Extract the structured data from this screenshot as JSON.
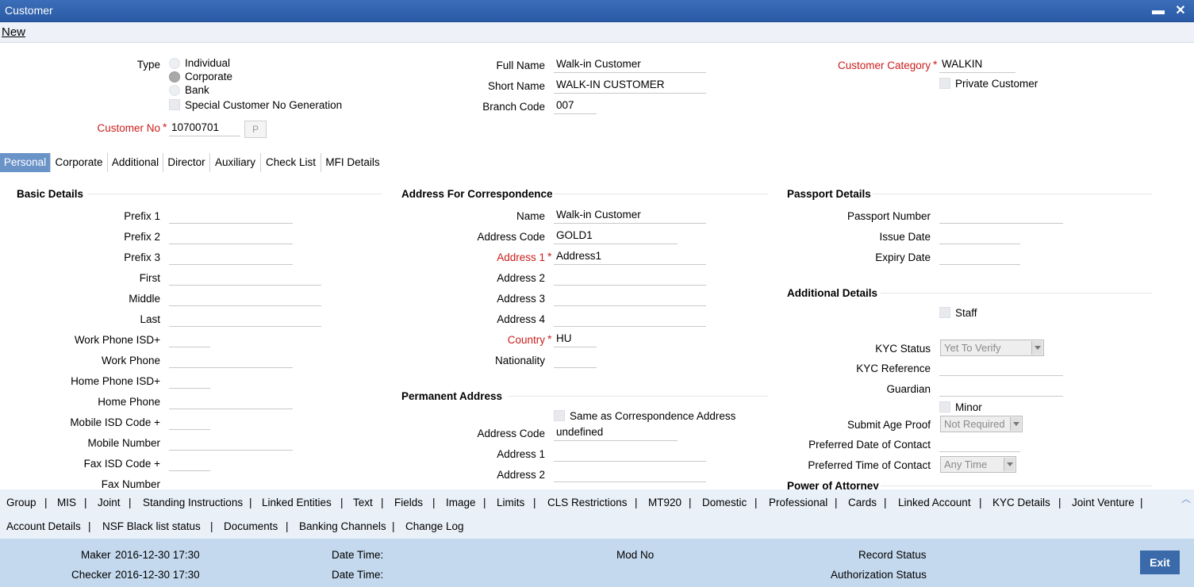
{
  "window": {
    "title": "Customer",
    "minimize": "▬",
    "close": "✕"
  },
  "toolbar": {
    "new_label": "New"
  },
  "header": {
    "type_label": "Type",
    "type_options": [
      "Individual",
      "Corporate",
      "Bank"
    ],
    "type_selected": "Corporate",
    "special_no_label": "Special Customer No Generation",
    "customer_no_label": "Customer No",
    "customer_no_value": "10700701",
    "p_button": "P",
    "full_name_label": "Full Name",
    "full_name_value": "Walk-in Customer",
    "short_name_label": "Short Name",
    "short_name_value": "WALK-IN CUSTOMER",
    "branch_code_label": "Branch Code",
    "branch_code_value": "007",
    "category_label": "Customer Category",
    "category_value": "WALKIN",
    "private_label": "Private Customer",
    "required_mark": "*"
  },
  "tabs": [
    "Personal",
    "Corporate",
    "Additional",
    "Director",
    "Auxiliary",
    "Check List",
    "MFI Details"
  ],
  "active_tab": "Personal",
  "basic": {
    "title": "Basic Details",
    "labels": [
      "Prefix 1",
      "Prefix 2",
      "Prefix 3",
      "First",
      "Middle",
      "Last",
      "Work Phone ISD+",
      "Work Phone",
      "Home Phone ISD+",
      "Home Phone",
      "Mobile ISD Code +",
      "Mobile Number",
      "Fax ISD Code +",
      "Fax Number"
    ]
  },
  "correspondence": {
    "title": "Address For Correspondence",
    "name_label": "Name",
    "name_value": "Walk-in Customer",
    "code_label": "Address Code",
    "code_value": "GOLD1",
    "addr1_label": "Address 1",
    "addr1_value": "Address1",
    "addr2_label": "Address 2",
    "addr3_label": "Address 3",
    "addr4_label": "Address 4",
    "country_label": "Country",
    "country_value": "HU",
    "nationality_label": "Nationality"
  },
  "permanent": {
    "title": "Permanent Address",
    "same_label": "Same as Correspondence Address",
    "code_label": "Address Code",
    "code_value": "undefined",
    "addr1_label": "Address 1",
    "addr2_label": "Address 2"
  },
  "passport": {
    "title": "Passport Details",
    "number_label": "Passport Number",
    "issue_label": "Issue Date",
    "expiry_label": "Expiry Date"
  },
  "additional": {
    "title": "Additional Details",
    "staff_label": "Staff",
    "kyc_status_label": "KYC Status",
    "kyc_status_value": "Yet To Verify",
    "kyc_ref_label": "KYC Reference",
    "guardian_label": "Guardian",
    "minor_label": "Minor",
    "age_proof_label": "Submit Age Proof",
    "age_proof_value": "Not Required",
    "pref_date_label": "Preferred Date of Contact",
    "pref_time_label": "Preferred Time of Contact",
    "pref_time_value": "Any Time",
    "poa_title": "Power of Attorney"
  },
  "bottom_links_row1": [
    "Group",
    "MIS",
    "Joint",
    "Standing Instructions",
    "Linked Entities",
    "Text",
    "Fields",
    "Image",
    "Limits",
    "CLS Restrictions",
    "MT920",
    "Domestic",
    "Professional",
    "Cards",
    "Linked Account",
    "KYC Details",
    "Joint Venture"
  ],
  "bottom_links_row2": [
    "Account Details",
    "NSF Black list status",
    "Documents",
    "Banking Channels",
    "Change Log"
  ],
  "separator": "|",
  "scroll_up": "︿",
  "footer": {
    "maker_label": "Maker",
    "maker_value": "2016-12-30 17:30",
    "checker_label": "Checker",
    "checker_value": "2016-12-30 17:30",
    "datetime_label": "Date Time:",
    "mod_no_label": "Mod No",
    "record_status_label": "Record Status",
    "auth_status_label": "Authorization Status",
    "exit_label": "Exit"
  }
}
